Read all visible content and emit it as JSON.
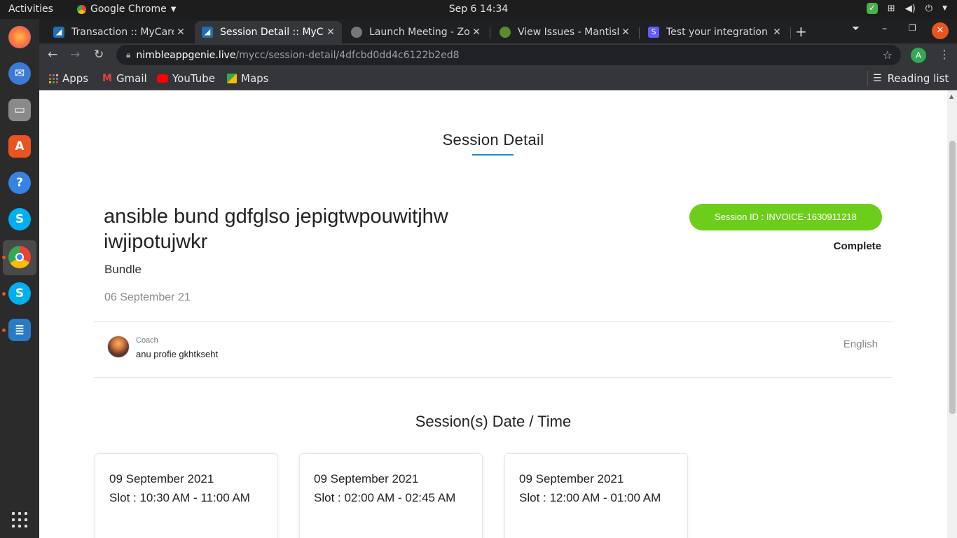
{
  "system": {
    "activities": "Activities",
    "app_name": "Google Chrome",
    "clock": "Sep 6  14:34"
  },
  "dock": {
    "icons": [
      "firefox-icon",
      "thunderbird-icon",
      "files-icon",
      "software-center-icon",
      "help-icon",
      "skype-icon",
      "chrome-icon",
      "skype-icon",
      "libreoffice-writer-icon"
    ]
  },
  "browser": {
    "tabs": [
      {
        "title": "Transaction :: MyCare",
        "active": false
      },
      {
        "title": "Session Detail :: MyCa",
        "active": true
      },
      {
        "title": "Launch Meeting - Zoo",
        "active": false
      },
      {
        "title": "View Issues - MantisB",
        "active": false
      },
      {
        "title": "Test your integration",
        "active": false
      }
    ],
    "url_host": "nimbleappgenie.live",
    "url_path": "/mycc/session-detail/4dfcbd0dd4c6122b2ed8",
    "profile_initial": "A",
    "bookmarks": [
      {
        "label": "Apps"
      },
      {
        "label": "Gmail"
      },
      {
        "label": "YouTube"
      },
      {
        "label": "Maps"
      }
    ],
    "reading_list": "Reading list"
  },
  "page": {
    "heading": "Session Detail",
    "session_name": "ansible bund gdfglso jepigtwpouwitjhw iwjipotujwkr",
    "session_type": "Bundle",
    "session_date": "06 September 21",
    "session_id": "Session ID : INVOICE-1630911218",
    "status": "Complete",
    "coach_label": "Coach",
    "coach_name": "anu profie gkhtkseht",
    "language": "English",
    "slots_heading": "Session(s) Date / Time",
    "slots": [
      {
        "date": "09 September 2021",
        "time": "Slot : 10:30 AM - 11:00 AM"
      },
      {
        "date": "09 September 2021",
        "time": "Slot : 02:00 AM - 02:45 AM"
      },
      {
        "date": "09 September 2021",
        "time": "Slot : 12:00 AM - 01:00 AM"
      }
    ]
  },
  "colors": {
    "accent_blue": "#1f8ac4",
    "session_id_green": "#6cce1b",
    "ubuntu_orange": "#e95420"
  }
}
